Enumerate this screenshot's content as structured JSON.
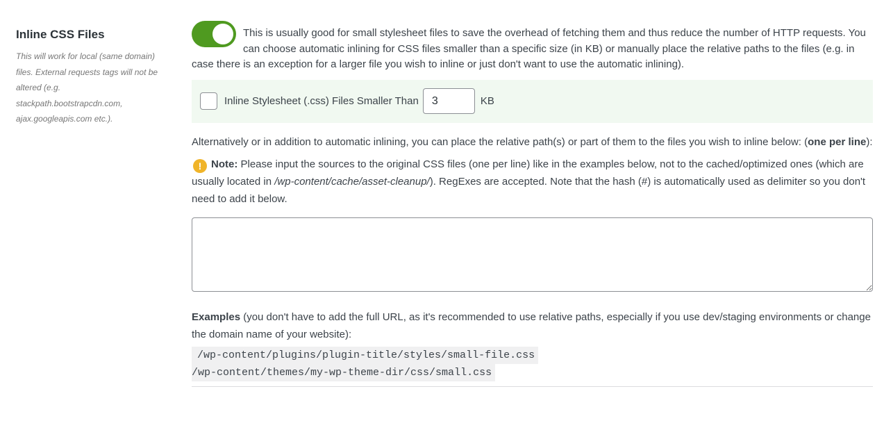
{
  "section": {
    "title": "Inline CSS Files",
    "description": "This will work for local (same domain) files. External requests tags will not be altered (e.g. stackpath.bootstrapcdn.com, ajax.googleapis.com etc.)."
  },
  "toggle": {
    "state": "on",
    "color": "#4f9a20"
  },
  "intro_text": "This is usually good for small stylesheet files to save the overhead of fetching them and thus reduce the number of HTTP requests. You can choose automatic inlining for CSS files smaller than a specific size (in KB) or manually place the relative paths to the files (e.g. in case there is an exception for a larger file you wish to inline or just don't want to use the automatic inlining).",
  "auto_inline": {
    "checked": false,
    "label": "Inline Stylesheet (.css) Files Smaller Than",
    "value": "3",
    "unit": "KB",
    "background": "#f1f9f1"
  },
  "alternative": {
    "text": "Alternatively or in addition to automatic inlining, you can place the relative path(s) or part of them to the files you wish to inline below: ",
    "bold": "one per line",
    "tail": "):",
    "open_paren": "("
  },
  "note": {
    "icon": "warning-icon",
    "label": "Note:",
    "text_before": " Please input the sources to the original CSS files (one per line) like in the examples below, not to the cached/optimized ones (which are usually located in ",
    "path": "/wp-content/cache/asset-cleanup/",
    "text_after": "). RegExes are accepted. Note that the hash (#) is automatically used as delimiter so you don't need to add it below."
  },
  "paths_textarea": {
    "value": ""
  },
  "examples": {
    "label": "Examples",
    "text": " (you don't have to add the full URL, as it's recommended to use relative paths, especially if you use dev/staging environments or change the domain name of your website):",
    "lines": [
      "/wp-content/plugins/plugin-title/styles/small-file.css",
      "/wp-content/themes/my-wp-theme-dir/css/small.css"
    ]
  }
}
